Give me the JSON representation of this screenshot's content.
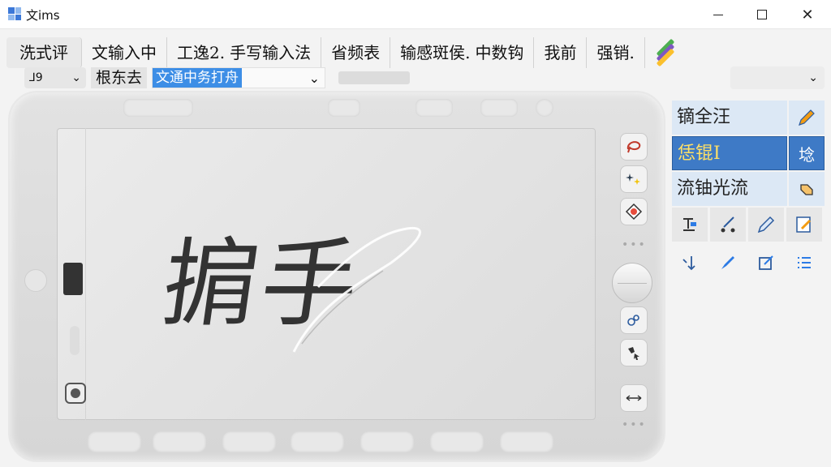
{
  "window": {
    "title": "文ims"
  },
  "menu": {
    "items": [
      "洗式评",
      "文输入中",
      "工逸2.",
      "手写输入法",
      "省频表",
      "输感斑侯.",
      "中数钩",
      "我前",
      "强销."
    ]
  },
  "toolbar2": {
    "language_label": "⅃9",
    "plain_label": "根东去",
    "selected_text": "文通中务打舟",
    "right_dropdown_value": ""
  },
  "pad": {
    "handwriting_text": "掮手"
  },
  "right_panel": {
    "rows": [
      {
        "label": "镝全汪",
        "active": false
      },
      {
        "label": "恁锟I",
        "icon_text": "埝",
        "active": true
      },
      {
        "label": "流铀光流",
        "active": false
      }
    ]
  },
  "colors": {
    "accent": "#3e7ac6",
    "selection": "#3d8ee6",
    "panel_bg": "#dce8f5",
    "active_text": "#ffe066"
  }
}
